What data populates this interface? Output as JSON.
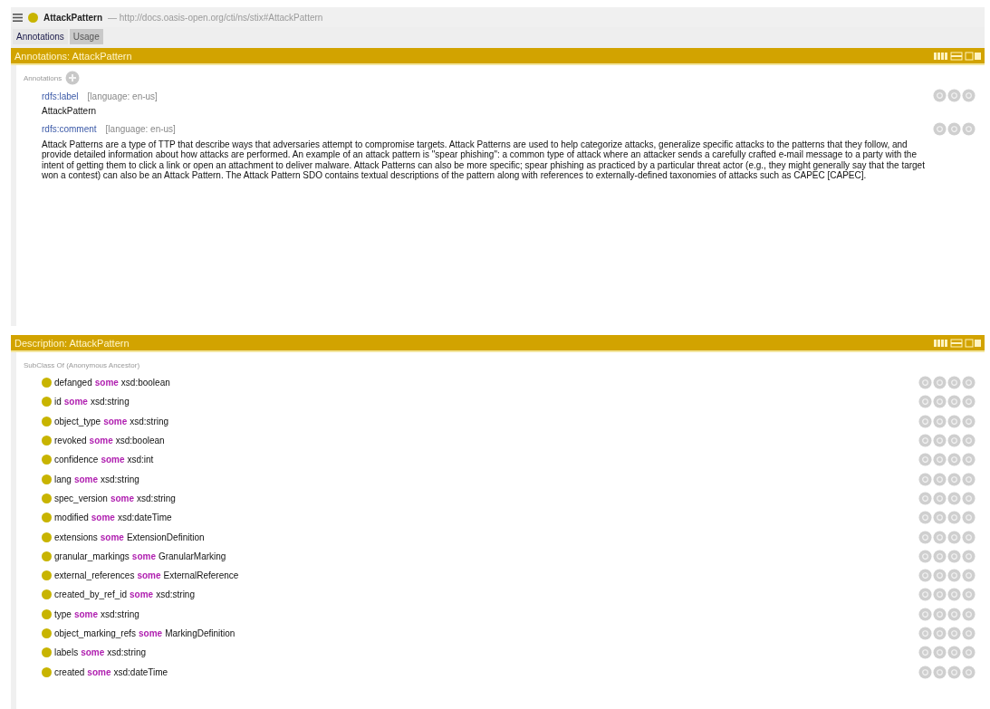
{
  "title_bar": {
    "entity": "AttackPattern",
    "iri": "— http://docs.oasis-open.org/cti/ns/stix#AttackPattern"
  },
  "tabs": [
    {
      "label": "Annotations",
      "selected": true
    },
    {
      "label": "Usage",
      "selected": false
    }
  ],
  "annotations_panel": {
    "title": "Annotations: AttackPattern",
    "section_label": "Annotations",
    "annotations": [
      {
        "property": "rdfs:label",
        "language": "[language: en-us]",
        "value": "AttackPattern"
      },
      {
        "property": "rdfs:comment",
        "language": "[language: en-us]",
        "value": "Attack Patterns are a type of TTP that describe ways that adversaries attempt to compromise targets. Attack Patterns are used to help categorize attacks, generalize specific attacks to the patterns that they follow, and provide detailed information about how attacks are performed. An example of an attack pattern is \"spear phishing\": a common type of attack where an attacker sends a carefully crafted e-mail message to a party with the intent of getting them to click a link or open an attachment to deliver malware. Attack Patterns can also be more specific; spear phishing as practiced by a particular threat actor (e.g., they might generally say that the target won a contest) can also be an Attack Pattern. The Attack Pattern SDO contains textual descriptions of the pattern along with references to externally-defined taxonomies of attacks such as CAPEC [CAPEC]."
      }
    ]
  },
  "description_panel": {
    "title": "Description: AttackPattern",
    "section_label": "SubClass Of (Anonymous Ancestor)",
    "restrictions": [
      {
        "property": "defanged",
        "quantifier": "some",
        "filler": "xsd:boolean"
      },
      {
        "property": "id",
        "quantifier": "some",
        "filler": "xsd:string"
      },
      {
        "property": "object_type",
        "quantifier": "some",
        "filler": "xsd:string"
      },
      {
        "property": "revoked",
        "quantifier": "some",
        "filler": "xsd:boolean"
      },
      {
        "property": "confidence",
        "quantifier": "some",
        "filler": "xsd:int"
      },
      {
        "property": "lang",
        "quantifier": "some",
        "filler": "xsd:string"
      },
      {
        "property": "spec_version",
        "quantifier": "some",
        "filler": "xsd:string"
      },
      {
        "property": "modified",
        "quantifier": "some",
        "filler": "xsd:dateTime"
      },
      {
        "property": "extensions",
        "quantifier": "some",
        "filler": "ExtensionDefinition"
      },
      {
        "property": "granular_markings",
        "quantifier": "some",
        "filler": "GranularMarking"
      },
      {
        "property": "external_references",
        "quantifier": "some",
        "filler": "ExternalReference"
      },
      {
        "property": "created_by_ref_id",
        "quantifier": "some",
        "filler": "xsd:string"
      },
      {
        "property": "type",
        "quantifier": "some",
        "filler": "xsd:string"
      },
      {
        "property": "object_marking_refs",
        "quantifier": "some",
        "filler": "MarkingDefinition"
      },
      {
        "property": "labels",
        "quantifier": "some",
        "filler": "xsd:string"
      },
      {
        "property": "created",
        "quantifier": "some",
        "filler": "xsd:dateTime"
      }
    ]
  }
}
